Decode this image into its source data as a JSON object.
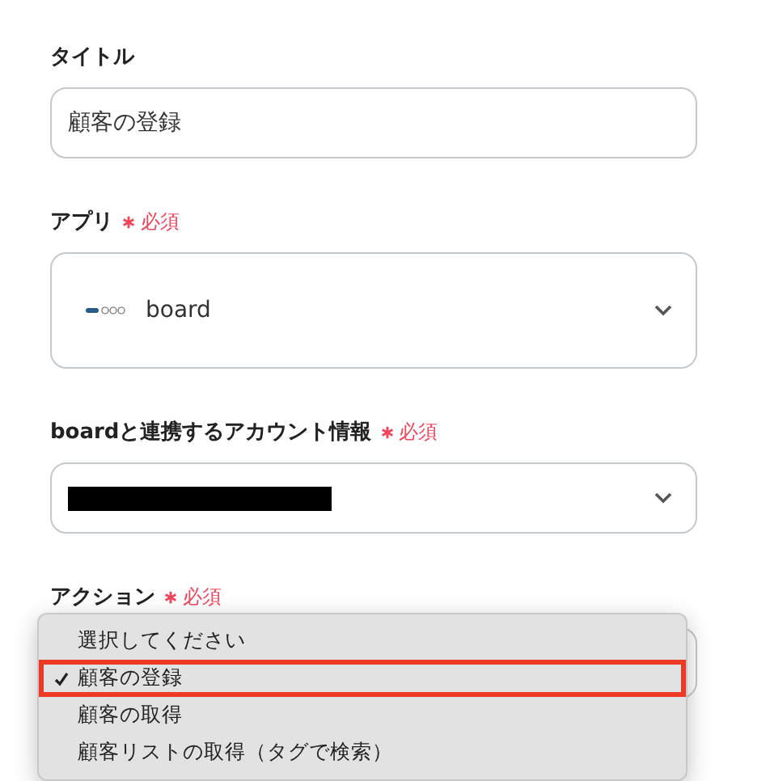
{
  "fields": [
    {
      "kind": "text",
      "label": "タイトル",
      "required": false,
      "value": "顧客の登録"
    },
    {
      "kind": "app",
      "label": "アプリ",
      "required": true,
      "required_text": "必須",
      "value": "board"
    },
    {
      "kind": "redacted",
      "label": "boardと連携するアカウント情報",
      "required": true,
      "required_text": "必須"
    },
    {
      "kind": "menu",
      "label": "アクション",
      "required": true,
      "required_text": "必須",
      "options": [
        {
          "label": "選択してください",
          "selected": false
        },
        {
          "label": "顧客の登録",
          "selected": true
        },
        {
          "label": "顧客の取得",
          "selected": false
        },
        {
          "label": "顧客リストの取得（タグで検索）",
          "selected": false
        }
      ]
    }
  ]
}
